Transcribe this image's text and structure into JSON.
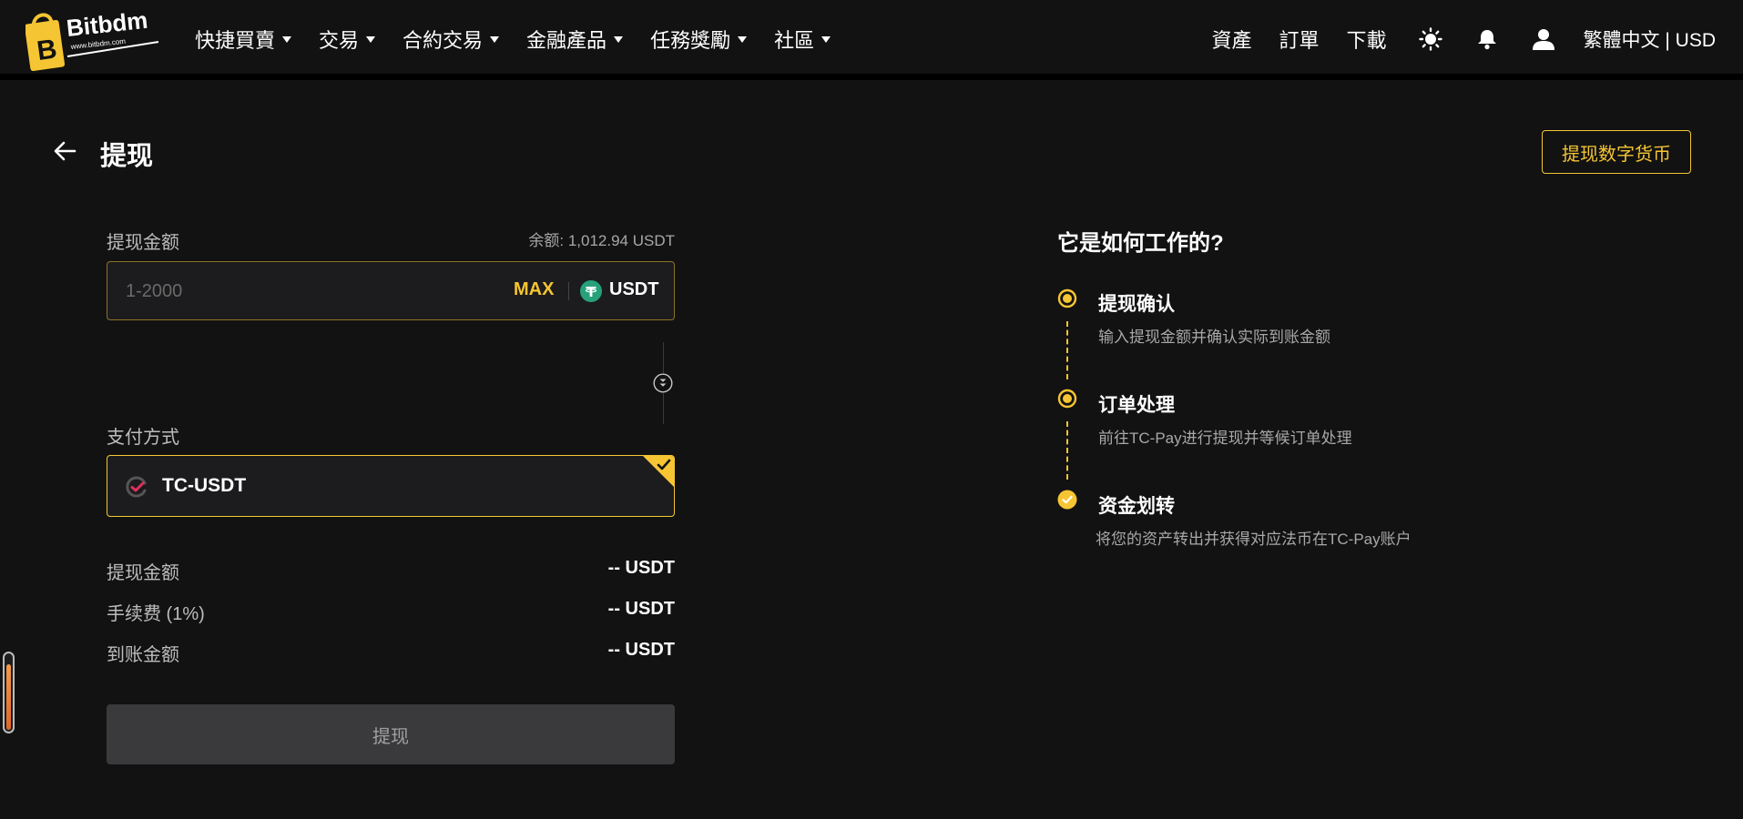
{
  "brand": {
    "name": "Bitbdm",
    "tagline": "www.bitbdm.com"
  },
  "nav": {
    "items": [
      {
        "label": "快捷買賣"
      },
      {
        "label": "交易"
      },
      {
        "label": "合約交易"
      },
      {
        "label": "金融產品"
      },
      {
        "label": "任務獎勵"
      },
      {
        "label": "社區"
      }
    ],
    "assets": "資產",
    "orders": "訂單",
    "download": "下載",
    "language_currency": "繁體中文 | USD"
  },
  "page": {
    "title": "提现",
    "crypto_withdraw_button": "提现数字货币"
  },
  "form": {
    "amount_label": "提现金额",
    "balance_text": "余额: 1,012.94  USDT",
    "amount_placeholder": "1-2000",
    "max_label": "MAX",
    "unit": "USDT",
    "payment_label": "支付方式",
    "payment_method": "TC-USDT",
    "summary": [
      {
        "label": "提现金额",
        "value": "--  USDT"
      },
      {
        "label": "手续费 (1%)",
        "value": "--  USDT"
      },
      {
        "label": "到账金额",
        "value": "--  USDT"
      }
    ],
    "submit_label": "提现"
  },
  "how_it_works": {
    "title": "它是如何工作的?",
    "steps": [
      {
        "title": "提现确认",
        "desc": "输入提现金额并确认实际到账金额"
      },
      {
        "title": "订单处理",
        "desc": "前往TC-Pay进行提现并等候订单处理"
      },
      {
        "title": "资金划转",
        "desc": "将您的资产转出并获得对应法币在TC-Pay账户"
      }
    ]
  },
  "colors": {
    "accent": "#f5c533",
    "background": "#121212",
    "usdt_green": "#26a17b"
  }
}
